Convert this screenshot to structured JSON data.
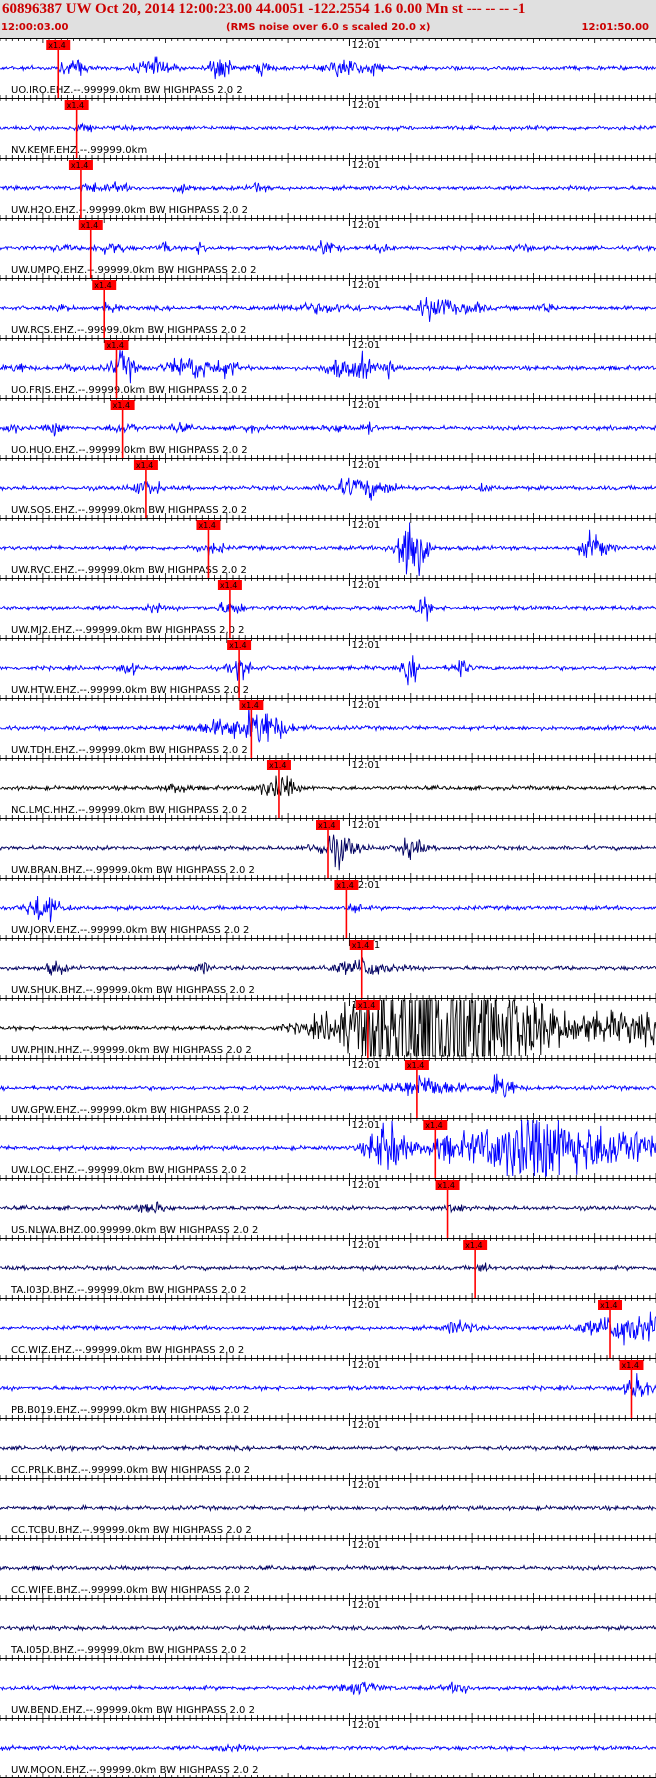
{
  "header": {
    "title": "60896387 UW Oct 20, 2014 12:00:23.00   44.0051 -122.2554  1.6 0.00 Mn st --- -- --   -1",
    "start_time": "12:00:03.00",
    "note": "(RMS noise over 6.0 s scaled 20.0 x)",
    "end_time": "12:01:50.00"
  },
  "chart_data": {
    "type": "line",
    "title": "60896387 UW Oct 20, 2014 12:00:23.00   44.0051 -122.2554  1.6 0.00 Mn st --- -- --   -1",
    "time_range_s": [
      3,
      110
    ],
    "mid_tick_label": "12:01",
    "pick_marker_label": "x1.4",
    "pick_color": "#ff0000",
    "traces": [
      {
        "label": "UO.IRO.EHZ.--.99999.0km BW  HIGHPASS  2.0  2",
        "color": "#0000ff",
        "pick_s": 12.5,
        "bursts": [
          [
            16,
            1.6,
            0.7
          ],
          [
            28,
            2.0,
            1.8
          ],
          [
            39,
            2.5,
            1.2
          ],
          [
            46,
            1.2,
            1.0
          ],
          [
            59,
            2.2,
            1.6
          ],
          [
            64,
            1.2,
            1.1
          ]
        ]
      },
      {
        "label": "NV.KEMF.EHZ.--.99999.0km",
        "color": "#0000ff",
        "pick_s": 15.5,
        "bursts": []
      },
      {
        "label": "UW.H2O.EHZ.--.99999.0km BW  HIGHPASS  2.0  2",
        "color": "#0000ff",
        "pick_s": 16.2,
        "bursts": [
          [
            22,
            0.8,
            1.4
          ],
          [
            33,
            0.8,
            1.0
          ],
          [
            45,
            1.0,
            0.8
          ]
        ]
      },
      {
        "label": "UW.UMPQ.EHZ.--.99999.0km BW  HIGHPASS  2.0  2",
        "color": "#0000ff",
        "pick_s": 17.8,
        "bursts": [
          [
            13,
            0.5,
            1.2
          ],
          [
            22,
            1.0,
            1.0
          ],
          [
            30,
            1.2,
            0.7
          ],
          [
            36,
            1.1,
            0.9
          ],
          [
            56,
            1.6,
            1.3
          ],
          [
            65,
            0.8,
            0.9
          ],
          [
            88,
            0.7,
            1.1
          ]
        ]
      },
      {
        "label": "UW.RCS.EHZ.--.99999.0km BW  HIGHPASS  2.0  2",
        "color": "#0000ff",
        "pick_s": 20.0,
        "bursts": [
          [
            13,
            0.5,
            1.0
          ],
          [
            55,
            0.8,
            5.0
          ],
          [
            74,
            2.6,
            2.0
          ],
          [
            80,
            1.2,
            1.3
          ],
          [
            92,
            0.8,
            1.0
          ]
        ]
      },
      {
        "label": "UO.FRIS.EHZ.--.99999.0km BW  HIGHPASS  2.0  2",
        "color": "#0000ff",
        "pick_s": 22.0,
        "bursts": [
          [
            6,
            1.0,
            1.0
          ],
          [
            15,
            0.8,
            1.0
          ],
          [
            23,
            2.3,
            1.5
          ],
          [
            34,
            2.5,
            2.5
          ],
          [
            40,
            1.5,
            1.5
          ],
          [
            58,
            2.0,
            1.5
          ],
          [
            62,
            2.5,
            1.2
          ],
          [
            66,
            1.8,
            0.8
          ]
        ]
      },
      {
        "label": "UO.HUO.EHZ.--.99999.0km BW  HIGHPASS  2.0  2",
        "color": "#0000ff",
        "pick_s": 23.0,
        "bursts": [
          [
            5,
            1.0,
            0.8
          ],
          [
            12,
            1.2,
            1.0
          ],
          [
            22,
            1.0,
            0.8
          ],
          [
            32,
            0.8,
            1.2
          ],
          [
            44,
            0.6,
            1.0
          ],
          [
            58,
            0.9,
            1.2
          ],
          [
            63,
            1.0,
            0.8
          ]
        ]
      },
      {
        "label": "UW.SOS.EHZ.--.99999.0km BW  HIGHPASS  2.0  2",
        "color": "#0000ff",
        "pick_s": 26.8,
        "bursts": [
          [
            26,
            1.2,
            1.4
          ],
          [
            62,
            2.0,
            3.5
          ],
          [
            82,
            0.6,
            1.0
          ]
        ]
      },
      {
        "label": "UW.RVC.EHZ.--.99999.0km BW  HIGHPASS  2.0  2",
        "color": "#0000ff",
        "pick_s": 37.0,
        "bursts": [
          [
            36,
            0.8,
            1.0
          ],
          [
            70,
            10.0,
            1.5
          ],
          [
            100,
            3.0,
            1.5
          ]
        ]
      },
      {
        "label": "UW.MJ2.EHZ.--.99999.0km BW  HIGHPASS  2.0  2",
        "color": "#0000ff",
        "pick_s": 40.5,
        "bursts": [
          [
            28,
            1.0,
            0.8
          ],
          [
            40,
            1.2,
            1.0
          ],
          [
            72,
            2.5,
            0.9
          ]
        ]
      },
      {
        "label": "UW.HTW.EHZ.--.99999.0km BW  HIGHPASS  2.0  2",
        "color": "#0000ff",
        "pick_s": 42.0,
        "bursts": [
          [
            24,
            1.5,
            0.8
          ],
          [
            42,
            1.5,
            1.2
          ],
          [
            70,
            3.0,
            0.8
          ],
          [
            78,
            2.0,
            0.9
          ]
        ]
      },
      {
        "label": "UW.TDH.EHZ.--.99999.0km BW  HIGHPASS  2.0  2",
        "color": "#0000ff",
        "pick_s": 44.0,
        "bursts": [
          [
            42,
            2.0,
            5.0
          ],
          [
            46,
            2.5,
            2.0
          ]
        ]
      },
      {
        "label": "NC.LMC.HHZ.--.99999.0km BW  HIGHPASS  2.0  2",
        "color": "#000000",
        "pick_s": 48.5,
        "bursts": [
          [
            32,
            1.0,
            1.2
          ],
          [
            48,
            2.0,
            2.0
          ]
        ]
      },
      {
        "label": "UW.BRAN.BHZ.--.99999.0km BW  HIGHPASS  2.0  2",
        "color": "#000060",
        "pick_s": 56.5,
        "bursts": [
          [
            58,
            2.5,
            2.5
          ],
          [
            70,
            2.0,
            1.5
          ]
        ]
      },
      {
        "label": "UW.JORV.EHZ.--.99999.0km BW  HIGHPASS  2.0  2",
        "color": "#0000ff",
        "pick_s": 59.5,
        "bursts": [
          [
            10,
            3.0,
            1.8
          ]
        ]
      },
      {
        "label": "UW.SHUK.BHZ.--.99999.0km BW  HIGHPASS  2.0  2",
        "color": "#000060",
        "pick_s": 62.0,
        "bursts": [
          [
            12,
            1.5,
            1.1
          ],
          [
            36,
            1.0,
            0.9
          ],
          [
            62,
            1.5,
            3.5
          ]
        ]
      },
      {
        "label": "UW.PHIN.HHZ.--.99999.0km BW  HIGHPASS  2.0  2",
        "color": "#000000",
        "pick_s": 63.0,
        "bursts": [
          [
            75,
            25.0,
            9.0
          ],
          [
            105,
            3.0,
            8.0
          ]
        ]
      },
      {
        "label": "UW.GPW.EHZ.--.99999.0km BW  HIGHPASS  2.0  2",
        "color": "#0000ff",
        "pick_s": 71.0,
        "bursts": [
          [
            72,
            2.0,
            4.0
          ],
          [
            85,
            3.0,
            1.3
          ]
        ]
      },
      {
        "label": "UW.LOC.EHZ.--.99999.0km BW  HIGHPASS  2.0  2",
        "color": "#0000ff",
        "pick_s": 74.0,
        "bursts": [
          [
            66,
            6.0,
            2.0
          ],
          [
            76,
            1.5,
            4.5
          ],
          [
            90,
            8.0,
            6.0
          ],
          [
            104,
            4.0,
            5.0
          ]
        ]
      },
      {
        "label": "US.NLWA.BHZ.00.99999.0km BW  HIGHPASS  2.0  2",
        "color": "#000060",
        "pick_s": 76.0,
        "bursts": [
          [
            28,
            1.0,
            1.8
          ]
        ]
      },
      {
        "label": "TA.I03D.BHZ.--.99999.0km BW  HIGHPASS  2.0  2",
        "color": "#000060",
        "pick_s": 80.5,
        "bursts": []
      },
      {
        "label": "CC.WIZ.EHZ.--.99999.0km BW  HIGHPASS  2.0  2",
        "color": "#0000ff",
        "pick_s": 102.5,
        "bursts": [
          [
            78,
            1.5,
            1.5
          ],
          [
            106,
            3.0,
            5.0
          ]
        ]
      },
      {
        "label": "PB.B019.EHZ.--.99999.0km BW  HIGHPASS  2.0  2",
        "color": "#0000ff",
        "pick_s": 106.0,
        "bursts": [
          [
            107,
            2.0,
            1.5
          ]
        ]
      },
      {
        "label": "CC.PRLK.BHZ.--.99999.0km BW  HIGHPASS  2.0  2",
        "color": "#000060",
        "pick_s": null,
        "bursts": []
      },
      {
        "label": "CC.TCBU.BHZ.--.99999.0km BW  HIGHPASS  2.0  2",
        "color": "#000060",
        "pick_s": null,
        "bursts": []
      },
      {
        "label": "CC.WIFE.BHZ.--.99999.0km BW  HIGHPASS  2.0  2",
        "color": "#000060",
        "pick_s": null,
        "bursts": []
      },
      {
        "label": "TA.I05D.BHZ.--.99999.0km BW  HIGHPASS  2.0  2",
        "color": "#000060",
        "pick_s": null,
        "bursts": []
      },
      {
        "label": "UW.BEND.EHZ.--.99999.0km BW  HIGHPASS  2.0  2",
        "color": "#0000ff",
        "pick_s": null,
        "bursts": [
          [
            62,
            1.2,
            2.0
          ],
          [
            78,
            1.0,
            1.5
          ]
        ]
      },
      {
        "label": "UW.MOON.EHZ.--.99999.0km BW  HIGHPASS  2.0  2",
        "color": "#0000ff",
        "pick_s": null,
        "bursts": [
          [
            40,
            0.5,
            2.0
          ]
        ]
      }
    ]
  }
}
